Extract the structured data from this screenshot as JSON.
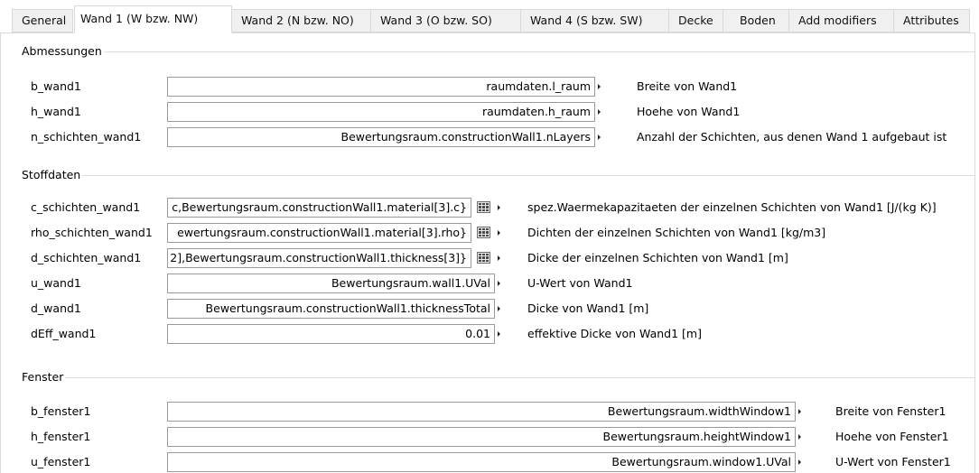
{
  "tabs": [
    {
      "label": "General"
    },
    {
      "label": "Wand 1 (W bzw. NW)"
    },
    {
      "label": "Wand 2 (N bzw. NO)"
    },
    {
      "label": "Wand 3 (O bzw. SO)"
    },
    {
      "label": "Wand 4 (S bzw. SW)"
    },
    {
      "label": "Decke"
    },
    {
      "label": "Boden"
    },
    {
      "label": "Add modifiers"
    },
    {
      "label": "Attributes"
    }
  ],
  "active_tab": "Wand 1 (W bzw. NW)",
  "groups": {
    "abmessungen": {
      "title": "Abmessungen",
      "rows": [
        {
          "name": "b_wand1",
          "value": "raumdaten.l_raum",
          "description": "Breite von Wand1"
        },
        {
          "name": "h_wand1",
          "value": "raumdaten.h_raum",
          "description": "Hoehe von Wand1"
        },
        {
          "name": "n_schichten_wand1",
          "value": "Bewertungsraum.constructionWall1.nLayers",
          "description": "Anzahl der Schichten, aus denen Wand 1 aufgebaut ist"
        }
      ]
    },
    "stoffdaten": {
      "title": "Stoffdaten",
      "rows": [
        {
          "name": "c_schichten_wand1",
          "value": "c,Bewertungsraum.constructionWall1.material[3].c}",
          "description": "spez.Waermekapazitaeten der einzelnen Schichten von Wand1 [J/(kg K)]"
        },
        {
          "name": "rho_schichten_wand1",
          "value": "ewertungsraum.constructionWall1.material[3].rho}",
          "description": "Dichten der einzelnen Schichten von Wand1 [kg/m3]"
        },
        {
          "name": "d_schichten_wand1",
          "value": "2],Bewertungsraum.constructionWall1.thickness[3]}",
          "description": "Dicke der einzelnen Schichten von Wand1 [m]"
        },
        {
          "name": "u_wand1",
          "value": "Bewertungsraum.wall1.UVal",
          "description": "U-Wert von Wand1"
        },
        {
          "name": "d_wand1",
          "value": "Bewertungsraum.constructionWall1.thicknessTotal",
          "description": "Dicke von Wand1 [m]"
        },
        {
          "name": "dEff_wand1",
          "value": "0.01",
          "description": "effektive Dicke von Wand1 [m]"
        }
      ]
    },
    "fenster": {
      "title": "Fenster",
      "rows": [
        {
          "name": "b_fenster1",
          "value": "Bewertungsraum.widthWindow1",
          "description": "Breite von Fenster1"
        },
        {
          "name": "h_fenster1",
          "value": "Bewertungsraum.heightWindow1",
          "description": "Hoehe von Fenster1"
        },
        {
          "name": "u_fenster1",
          "value": "Bewertungsraum.window1.UVal",
          "description": "U-Wert von Fenster1"
        }
      ]
    }
  },
  "icons": {
    "matrix_editor": "matrix-editor-icon",
    "expand_arrow": "triangle-right-icon"
  }
}
